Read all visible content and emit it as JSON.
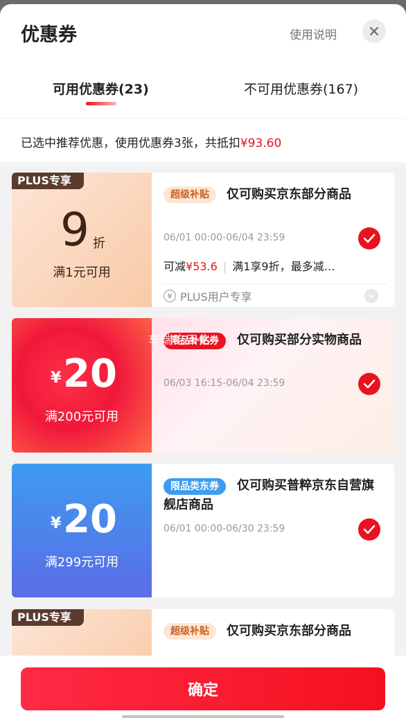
{
  "header": {
    "title": "优惠券",
    "help": "使用说明"
  },
  "tabs": [
    {
      "label": "可用优惠券(23)"
    },
    {
      "label": "不可用优惠券(167)"
    }
  ],
  "summary": {
    "text": "已选中推荐优惠，使用优惠券3张，共抵扣",
    "amount": "¥93.60"
  },
  "coupons": [
    {
      "badge": "PLUS专享",
      "value": "9",
      "unit": "折",
      "condition": "满1元可用",
      "tag": "超级补贴",
      "title": "仅可购买京东部分商品",
      "date": "06/01 00:00-06/04 23:59",
      "deduct_prefix": "可减",
      "deduct_amount": "¥53.6",
      "deduct_detail": "满1享9折，最多减…",
      "footer": "PLUS用户专享",
      "selected": true
    },
    {
      "currency": "¥",
      "value": "20",
      "condition": "满200元可用",
      "tag": "限品补贴券",
      "title": "仅可购买部分实物商品",
      "date": "06/03 16:15-06/04 23:59",
      "watermark": "车端吃云化",
      "selected": true
    },
    {
      "currency": "¥",
      "value": "20",
      "condition": "满299元可用",
      "tag": "限品类东券",
      "title": "仅可购买普粹京东自营旗舰店商品",
      "date": "06/01 00:00-06/30 23:59",
      "selected": true
    },
    {
      "badge": "PLUS专享",
      "tag": "超级补贴",
      "title": "仅可购买京东部分商品"
    }
  ],
  "footer": {
    "confirm": "确定"
  },
  "colors": {
    "accent": "#e8131f",
    "plus_badge": "#5a3b2e",
    "blue_coupon": "#3d9cf0"
  }
}
